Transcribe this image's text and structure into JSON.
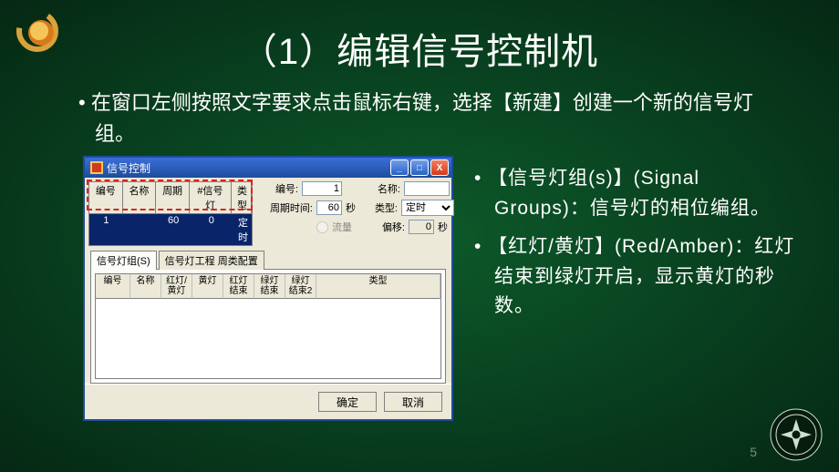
{
  "title": "（1）编辑信号控制机",
  "intro": "在窗口左侧按照文字要求点击鼠标右键，选择【新建】创建一个新的信号灯组。",
  "window": {
    "caption": "信号控制",
    "grid_headers": {
      "num": "编号",
      "name": "名称",
      "period": "周期",
      "sig": "#信号灯",
      "type": "类型"
    },
    "grid_row": {
      "num": "1",
      "name": "",
      "period": "60",
      "sig": "0",
      "type": "定时"
    },
    "form": {
      "num_label": "编号:",
      "num_value": "1",
      "name_label": "名称:",
      "name_value": "",
      "period_label": "周期时间:",
      "period_value": "60",
      "period_unit": "秒",
      "type_label": "类型:",
      "type_value": "定时",
      "flow_label": "流量",
      "offset_label": "偏移:",
      "offset_value": "0",
      "offset_unit": "秒"
    },
    "tabs": {
      "t1": "信号灯组(S)",
      "t2": "信号灯工程 周类配置"
    },
    "inner_headers": {
      "h1": "编号",
      "h2": "名称",
      "h3": "红灯/\n黄灯",
      "h4": "黄灯",
      "h5": "红灯\n结束",
      "h6": "绿灯\n结束",
      "h7": "绿灯\n结束2",
      "h8": "类型"
    },
    "buttons": {
      "ok": "确定",
      "cancel": "取消"
    }
  },
  "bullets": {
    "b1": "【信号灯组(s)】(Signal Groups)：信号灯的相位编组。",
    "b2": "【红灯/黄灯】(Red/Amber)：红灯结束到绿灯开启，显示黄灯的秒数。"
  },
  "page_number": "5"
}
